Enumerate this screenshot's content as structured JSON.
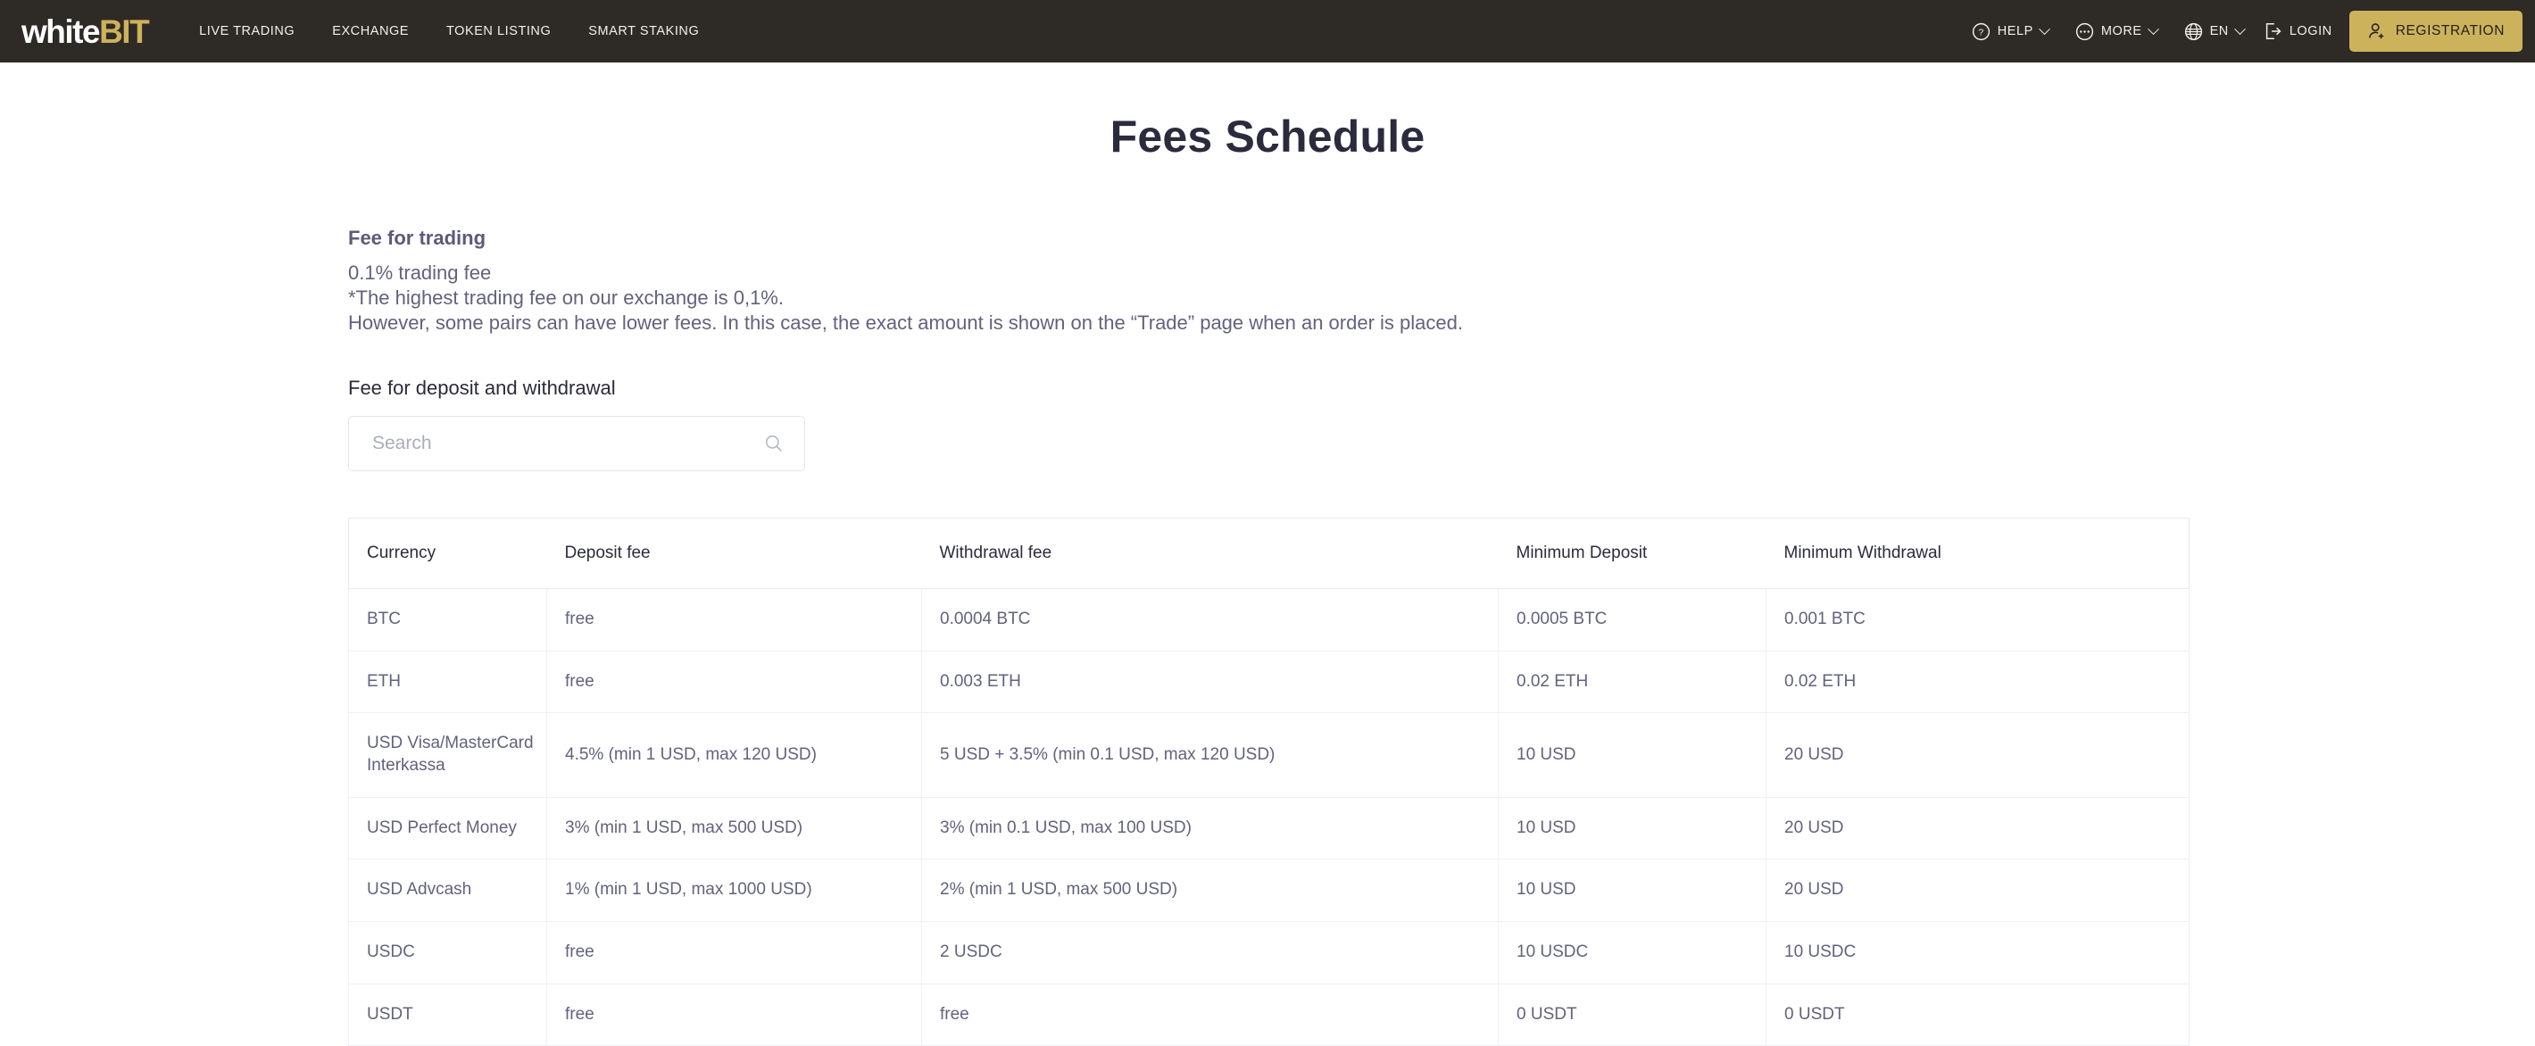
{
  "brand": {
    "name_white": "white",
    "name_accent": "BIT",
    "accent_color": "#cdb25c"
  },
  "nav": {
    "items": [
      {
        "label": "LIVE TRADING"
      },
      {
        "label": "EXCHANGE"
      },
      {
        "label": "TOKEN LISTING"
      },
      {
        "label": "SMART STAKING"
      }
    ],
    "right": {
      "help": "HELP",
      "more": "MORE",
      "lang": "EN",
      "login": "LOGIN",
      "registration": "REGISTRATION"
    }
  },
  "page": {
    "title": "Fees Schedule",
    "trading_heading": "Fee for trading",
    "trading_lines": [
      "0.1% trading fee",
      "*The highest trading fee on our exchange is 0,1%.",
      "However, some pairs can have lower fees. In this case, the exact amount is shown on the “Trade” page when an order is placed."
    ],
    "deposit_heading": "Fee for deposit and withdrawal"
  },
  "search": {
    "value": "",
    "placeholder": "Search"
  },
  "table": {
    "columns": [
      "Currency",
      "Deposit fee",
      "Withdrawal fee",
      "Minimum Deposit",
      "Minimum Withdrawal"
    ],
    "rows": [
      {
        "currency": "BTC",
        "deposit_fee": "free",
        "withdrawal_fee": "0.0004 BTC",
        "min_deposit": "0.0005 BTC",
        "min_withdrawal": "0.001 BTC"
      },
      {
        "currency": "ETH",
        "deposit_fee": "free",
        "withdrawal_fee": "0.003 ETH",
        "min_deposit": "0.02 ETH",
        "min_withdrawal": "0.02 ETH"
      },
      {
        "currency": "USD Visa/MasterCard Interkassa",
        "deposit_fee": "4.5% (min 1 USD, max 120 USD)",
        "withdrawal_fee": "5 USD + 3.5% (min 0.1 USD, max 120 USD)",
        "min_deposit": "10 USD",
        "min_withdrawal": "20 USD"
      },
      {
        "currency": "USD Perfect Money",
        "deposit_fee": "3% (min 1 USD, max 500 USD)",
        "withdrawal_fee": "3% (min 0.1 USD, max 100 USD)",
        "min_deposit": "10 USD",
        "min_withdrawal": "20 USD"
      },
      {
        "currency": "USD Advcash",
        "deposit_fee": "1% (min 1 USD, max 1000 USD)",
        "withdrawal_fee": "2% (min 1 USD, max 500 USD)",
        "min_deposit": "10 USD",
        "min_withdrawal": "20 USD"
      },
      {
        "currency": "USDC",
        "deposit_fee": "free",
        "withdrawal_fee": "2 USDC",
        "min_deposit": "10 USDC",
        "min_withdrawal": "10 USDC"
      },
      {
        "currency": "USDT",
        "deposit_fee": "free",
        "withdrawal_fee": "free",
        "min_deposit": "0 USDT",
        "min_withdrawal": "0 USDT"
      }
    ]
  }
}
